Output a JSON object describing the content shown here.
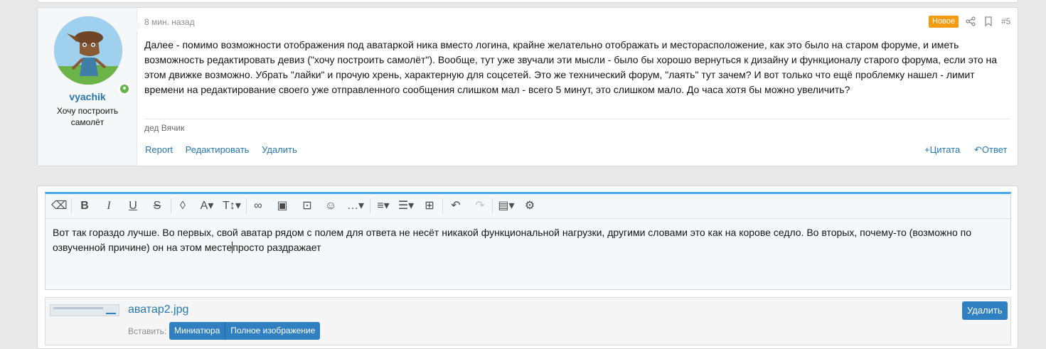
{
  "post": {
    "username": "vyachik",
    "user_title": "Хочу построить самолёт",
    "time": "8 мин. назад",
    "badge": "Новое",
    "number": "#5",
    "message": "Далее - помимо возможности отображения под аватаркой ника вместо логина, крайне желательно отображать и месторасположение, как это было на старом форуме, и иметь возможность редактировать девиз (\"хочу построить самолёт\"). Вообще, тут уже звучали эти мысли - было бы хорошо вернуться к дизайну и функционалу старого форума, если это на этом движке возможно. Убрать \"лайки\" и прочую хрень, характерную для соцсетей. Это же технический форум, \"лаять\" тут зачем? И вот только что ещё проблемку нашел - лимит времени на редактирование своего уже отправленного сообщения слишком мал - всего 5 минут, это слишком мало. До часа хотя бы можно увеличить?",
    "signature": "дед Вячик",
    "actions": {
      "report": "Report",
      "edit": "Редактировать",
      "delete": "Удалить",
      "quote": "+Цитата",
      "reply": "Ответ"
    }
  },
  "editor": {
    "text_before_caret": "Вот так гораздо лучше. Во первых, свой аватар рядом с полем для ответа не несёт никакой функциональной нагрузки, другими словами это как на корове седло. Во вторых, почему-то (возможно по озвученной причине) он на этом месте",
    "text_after_caret": "просто раздражает",
    "toolbar": [
      "eraser-icon",
      "bold-icon",
      "italic-icon",
      "underline-icon",
      "strikethrough-icon",
      "text-color-icon",
      "font-family-icon",
      "font-size-icon",
      "link-icon",
      "image-icon",
      "media-icon",
      "emoji-icon",
      "more-icon",
      "align-icon",
      "list-icon",
      "table-icon",
      "undo-icon",
      "redo-icon",
      "drafts-icon",
      "settings-icon"
    ]
  },
  "attachment": {
    "filename": "аватар2.jpg",
    "insert_label": "Вставить:",
    "thumbnail_button": "Миниатюра",
    "full_button": "Полное изображение",
    "delete_button": "Удалить"
  },
  "colors": {
    "link": "#2577b1",
    "badge": "#f39c12",
    "button": "#2f7fc1",
    "editor_accent": "#47a7eb",
    "online": "#63b543"
  }
}
